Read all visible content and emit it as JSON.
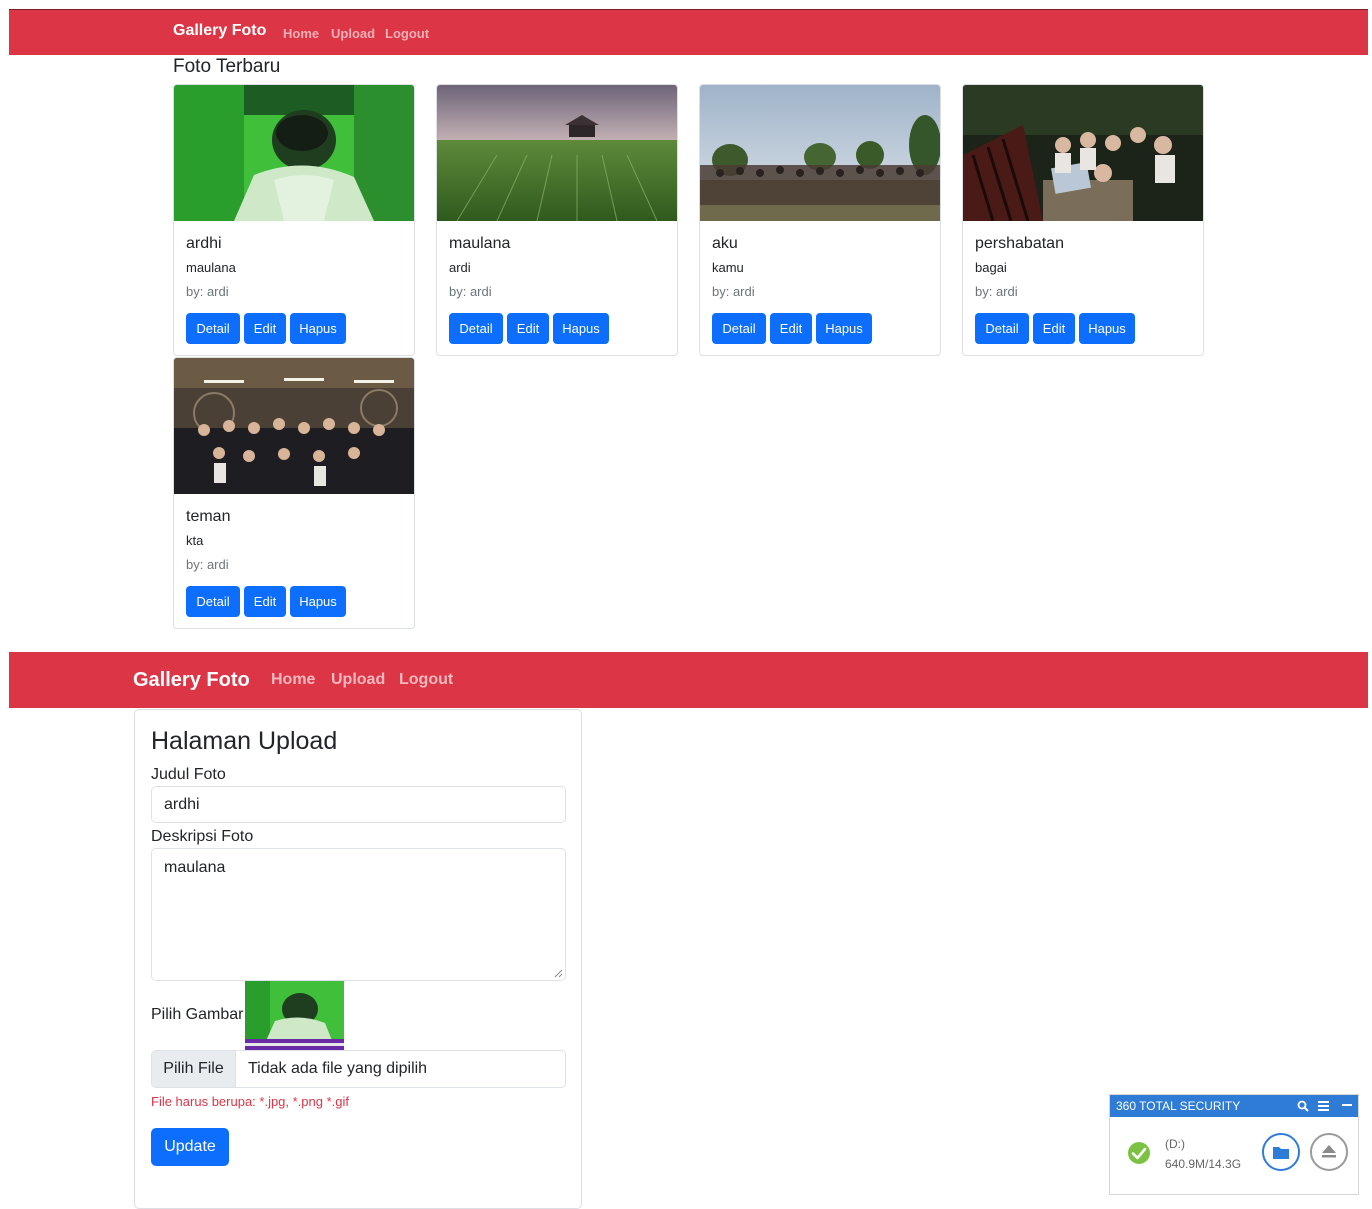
{
  "navbar_top": {
    "brand": "Gallery Foto",
    "links": [
      "Home",
      "Upload",
      "Logout"
    ]
  },
  "section_title": "Foto Terbaru",
  "cards": [
    {
      "title": "ardhi",
      "description": "maulana",
      "author": "by: ardi",
      "buttons": [
        "Detail",
        "Edit",
        "Hapus"
      ]
    },
    {
      "title": "maulana",
      "description": "ardi",
      "author": "by: ardi",
      "buttons": [
        "Detail",
        "Edit",
        "Hapus"
      ]
    },
    {
      "title": "aku",
      "description": "kamu",
      "author": "by: ardi",
      "buttons": [
        "Detail",
        "Edit",
        "Hapus"
      ]
    },
    {
      "title": "pershabatan",
      "description": "bagai",
      "author": "by: ardi",
      "buttons": [
        "Detail",
        "Edit",
        "Hapus"
      ]
    },
    {
      "title": "teman",
      "description": "kta",
      "author": "by: ardi",
      "buttons": [
        "Detail",
        "Edit",
        "Hapus"
      ]
    }
  ],
  "navbar_bottom": {
    "brand": "Gallery Foto",
    "links": [
      "Home",
      "Upload",
      "Logout"
    ]
  },
  "upload_form": {
    "title": "Halaman Upload",
    "judul_label": "Judul Foto",
    "judul_value": "ardhi",
    "deskripsi_label": "Deskripsi Foto",
    "deskripsi_value": "maulana",
    "gambar_label": "Pilih Gambar",
    "file_button": "Pilih File",
    "file_status": "Tidak ada file yang dipilih",
    "hint": "File harus berupa: *.jpg, *.png *.gif",
    "submit": "Update"
  },
  "security_widget": {
    "title": "360 TOTAL SECURITY",
    "drive": "(D:)",
    "usage": "640.9M/14.3G",
    "accent": "#2e7cd6"
  },
  "colors": {
    "navbar": "#dc3545",
    "button": "#0d6efd"
  }
}
